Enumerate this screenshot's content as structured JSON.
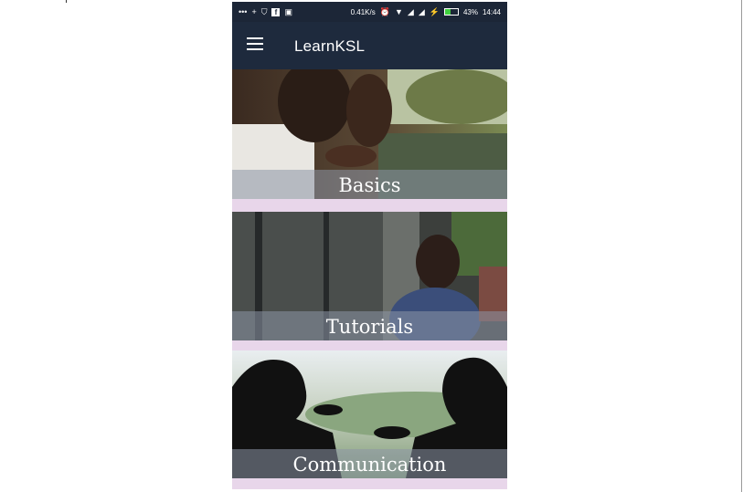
{
  "status_bar": {
    "left_icons": [
      "dots-icon",
      "plus-icon",
      "shield-icon",
      "facebook-icon",
      "message-icon"
    ],
    "network_speed": "0.41K/s",
    "battery_percent": "43%",
    "battery_level": 0.43,
    "time": "14:44"
  },
  "app_bar": {
    "title": "LearnKSL"
  },
  "cards": [
    {
      "label": "Basics"
    },
    {
      "label": "Tutorials"
    },
    {
      "label": "Communication"
    }
  ],
  "colors": {
    "app_bar": "#1e2a3d",
    "status_bar": "#1c2637",
    "card_divider": "#e8d6ea"
  }
}
